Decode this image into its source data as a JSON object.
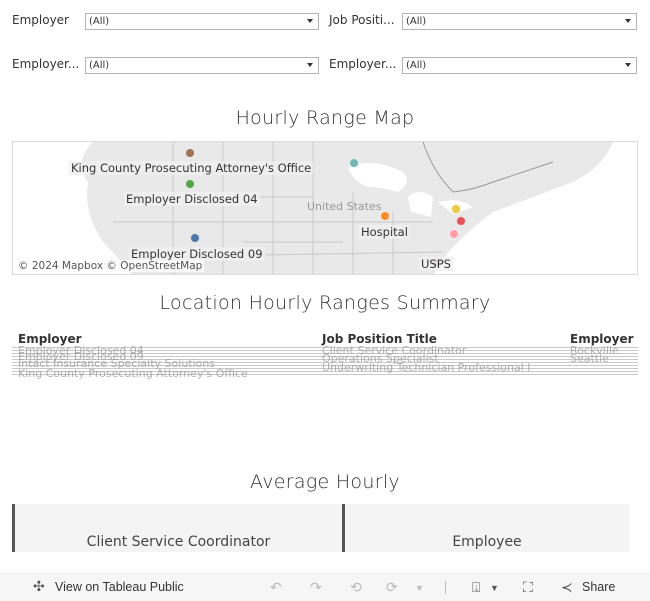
{
  "filters": [
    {
      "label": "Employer",
      "value": "(All)"
    },
    {
      "label": "Job Positi...",
      "value": "(All)"
    },
    {
      "label": "Employer...",
      "value": "(All)"
    },
    {
      "label": "Employer...",
      "value": "(All)"
    }
  ],
  "map_section": {
    "title": "Hourly Range Map",
    "place_label": "United States",
    "attribution": "© 2024 Mapbox  © OpenStreetMap",
    "points": [
      {
        "label": "",
        "color": "#9c7459"
      },
      {
        "label": "King County Prosecuting Attorney's Office",
        "color": ""
      },
      {
        "label": "",
        "color": "#59a14f"
      },
      {
        "label": "Employer Disclosed 04",
        "color": ""
      },
      {
        "label": "",
        "color": "#4e79a7"
      },
      {
        "label": "Employer Disclosed 09",
        "color": ""
      },
      {
        "label": "",
        "color": "#76b7b2"
      },
      {
        "label": "",
        "color": "#f28e2b"
      },
      {
        "label": "Hospital",
        "color": ""
      },
      {
        "label": "",
        "color": "#edc948"
      },
      {
        "label": "",
        "color": "#e15759"
      },
      {
        "label": "",
        "color": "#ff9da7"
      },
      {
        "label": "",
        "color": "#b07aa1"
      },
      {
        "label": "USPS",
        "color": ""
      }
    ]
  },
  "summary_section": {
    "title": "Location Hourly Ranges Summary",
    "columns": [
      "Employer",
      "Job Position Title",
      "Employer Ci"
    ],
    "rows_visible": [
      [
        "Intact Insurance Specialty Solutions",
        "Underwriting Technician Professional I",
        ""
      ],
      [
        "King County Prosecuting Attorney's Office",
        "",
        ""
      ]
    ],
    "rows_partial": [
      [
        "Employer Disclosed 04",
        "Client Service Coordinator",
        "Rockville"
      ],
      [
        "Employer Disclosed 09",
        "Operations Specialist",
        "Seattle"
      ]
    ]
  },
  "average_section": {
    "title": "Average Hourly",
    "cells": [
      "Client Service Coordinator",
      "Employee"
    ]
  },
  "toolbar": {
    "view_label": "View on Tableau Public",
    "share_label": "Share"
  }
}
